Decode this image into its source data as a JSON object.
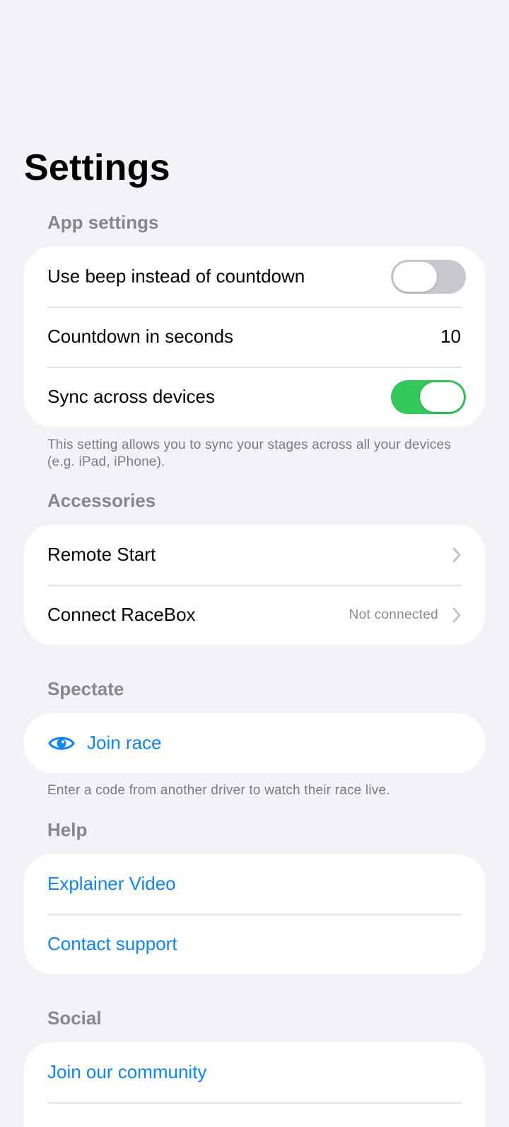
{
  "page": {
    "title": "Settings"
  },
  "app_settings": {
    "header": "App settings",
    "rows": [
      {
        "label": "Use beep instead of countdown",
        "control": "toggle",
        "state": "off"
      },
      {
        "label": "Countdown in seconds",
        "value": "10"
      },
      {
        "label": "Sync across devices",
        "control": "toggle",
        "state": "on"
      }
    ],
    "footnote": "This setting allows you to sync your stages across all your devices (e.g. iPad, iPhone)."
  },
  "accessories": {
    "header": "Accessories",
    "rows": [
      {
        "label": "Remote Start",
        "icon": "chevron-right-icon"
      },
      {
        "label": "Connect RaceBox",
        "secondary": "Not connected",
        "icon": "chevron-right-icon"
      }
    ]
  },
  "spectate": {
    "header": "Spectate",
    "rows": [
      {
        "label": "Join race",
        "icon": "eye-icon"
      }
    ],
    "footnote": "Enter a code from another driver to watch their race live."
  },
  "help": {
    "header": "Help",
    "rows": [
      {
        "label": "Explainer Video"
      },
      {
        "label": "Contact support"
      }
    ]
  },
  "social": {
    "header": "Social",
    "rows": [
      {
        "label": "Join our community"
      }
    ]
  },
  "colors": {
    "background": "#f2f2f7",
    "card": "#ffffff",
    "accent_blue": "#0a84ff",
    "toggle_on": "#34c759",
    "toggle_off": "#c7c7cc",
    "secondary_text": "#86868b"
  }
}
